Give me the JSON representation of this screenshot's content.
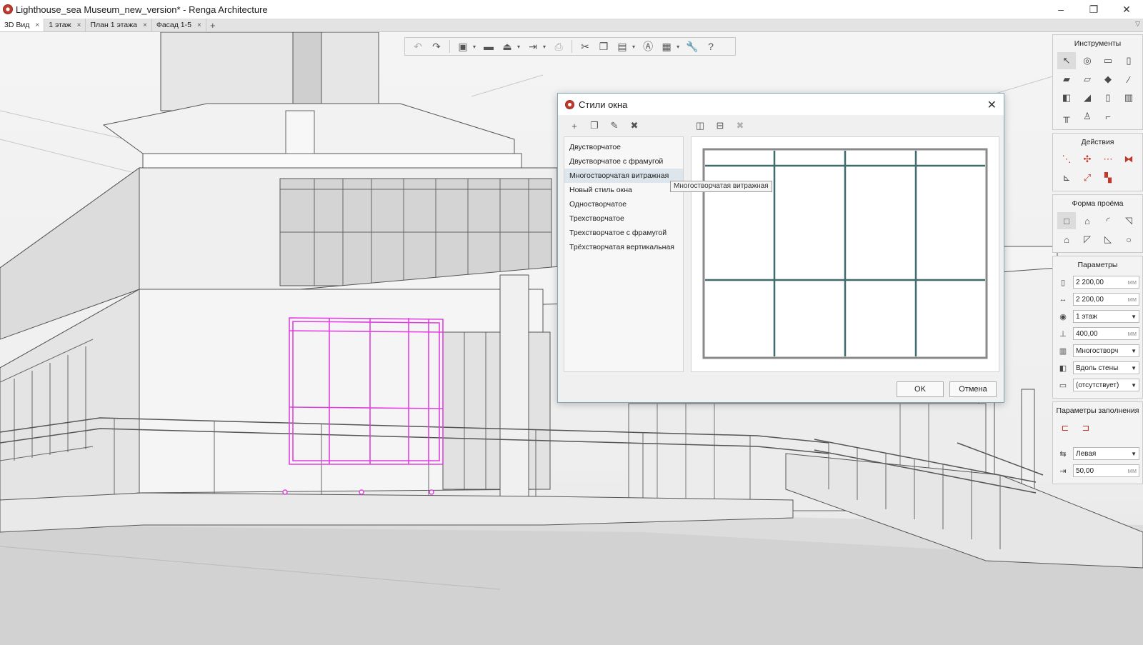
{
  "window": {
    "title": "Lighthouse_sea Museum_new_version* - Renga Architecture",
    "minimize": "–",
    "restore": "❐",
    "close": "✕"
  },
  "tabs": [
    {
      "label": "3D Вид",
      "active": true
    },
    {
      "label": "1 этаж",
      "active": false
    },
    {
      "label": "План 1 этажа",
      "active": false
    },
    {
      "label": "Фасад 1-5",
      "active": false
    }
  ],
  "tab_close_glyph": "×",
  "tab_add_glyph": "+",
  "tab_overflow_glyph": "▽",
  "toolbar": {
    "icons": [
      "undo-icon",
      "redo-icon",
      "view-cube-icon",
      "open-folder-icon",
      "save-icon",
      "export-icon",
      "print-icon",
      "cut-icon",
      "copy-icon",
      "paste-icon",
      "text-style-icon",
      "table-icon",
      "wrench-icon",
      "help-icon"
    ]
  },
  "right_panel": {
    "tools_title": "Инструменты",
    "actions_title": "Действия",
    "opening_shape_title": "Форма проёма",
    "params_title": "Параметры",
    "fill_params_title": "Параметры заполнения",
    "params": [
      {
        "value": "2 200,00",
        "unit": "мм",
        "dropdown": false
      },
      {
        "value": "2 200,00",
        "unit": "мм",
        "dropdown": false
      },
      {
        "value": "1 этаж",
        "unit": "",
        "dropdown": true
      },
      {
        "value": "400,00",
        "unit": "мм",
        "dropdown": false
      },
      {
        "value": "Многостворч",
        "unit": "",
        "dropdown": true
      },
      {
        "value": "Вдоль стены",
        "unit": "",
        "dropdown": true
      },
      {
        "value": "(отсутствует)",
        "unit": "",
        "dropdown": true
      }
    ],
    "fill_params": [
      {
        "value": "Левая",
        "unit": "",
        "dropdown": true
      },
      {
        "value": "50,00",
        "unit": "мм",
        "dropdown": false
      }
    ]
  },
  "dialog": {
    "title": "Стили окна",
    "close": "✕",
    "styles": [
      "Двустворчатое",
      "Двустворчатое с фрамугой",
      "Многостворчатая витражная",
      "Новый стиль окна",
      "Одностворчатое",
      "Трехстворчатое",
      "Трехстворчатое с фрамугой",
      "Трёхстворчатая вертикальная"
    ],
    "selected_index": 2,
    "tooltip": "Многостворчатая витражная",
    "ok_label": "OK",
    "cancel_label": "Отмена"
  },
  "colors": {
    "selection_magenta": "#e040e0",
    "frame_teal": "#3f6a6e",
    "accent_red": "#c0392b"
  }
}
